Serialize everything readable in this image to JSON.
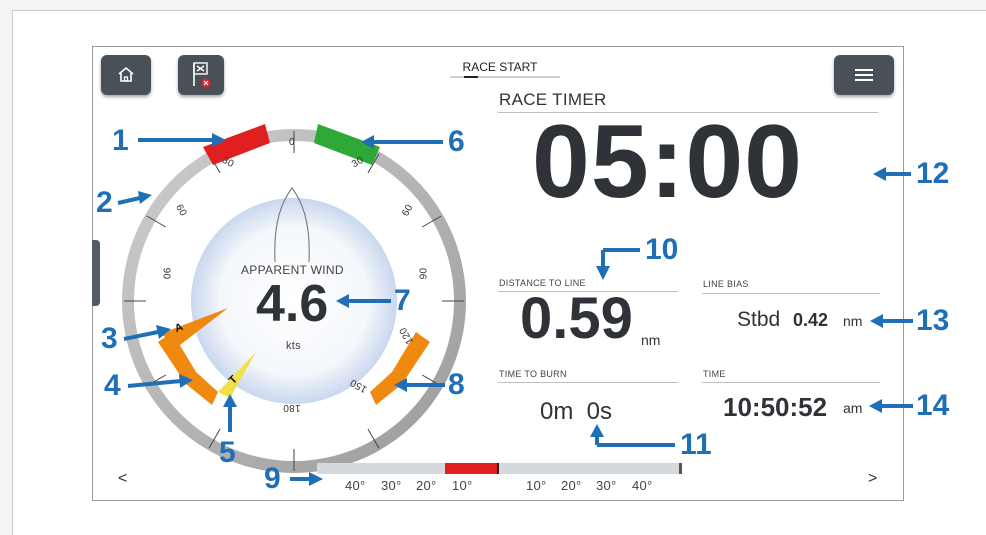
{
  "toolbar": {
    "home_icon": "home-icon",
    "race_flag_icon": "race-flag-icon",
    "menu_icon": "hamburger-menu-icon"
  },
  "tab": {
    "label": "RACE START"
  },
  "race_timer": {
    "title": "RACE TIMER",
    "value": "05:00"
  },
  "distance_to_line": {
    "label": "DISTANCE TO LINE",
    "value": "0.59",
    "unit": "nm"
  },
  "line_bias": {
    "label": "LINE BIAS",
    "prefix": "Stbd",
    "value": "0.42",
    "unit": "nm"
  },
  "time_to_burn": {
    "label": "TIME TO BURN",
    "value": "0m  0s"
  },
  "time": {
    "label": "TIME",
    "value": "10:50:52",
    "suffix": "am"
  },
  "wind": {
    "title": "APPARENT WIND",
    "value": "4.6",
    "unit": "kts",
    "scale_labels": [
      "0",
      "30",
      "30",
      "60",
      "60",
      "90",
      "90",
      "120",
      "150",
      "180"
    ],
    "pointer_a": "A",
    "pointer_t": "T"
  },
  "bias_bar": {
    "left_ticks": [
      "40°",
      "30°",
      "20°",
      "10°"
    ],
    "right_ticks": [
      "10°",
      "20°",
      "30°",
      "40°"
    ]
  },
  "nav": {
    "prev": "<",
    "next": ">"
  },
  "callouts": [
    "1",
    "2",
    "3",
    "4",
    "5",
    "6",
    "7",
    "8",
    "9",
    "10",
    "11",
    "12",
    "13",
    "14"
  ],
  "colors": {
    "accent": "#1f6fb6",
    "port_red": "#e02020",
    "starboard_green": "#2ea836",
    "orange": "#f0890f",
    "yellow": "#f1e04a"
  }
}
